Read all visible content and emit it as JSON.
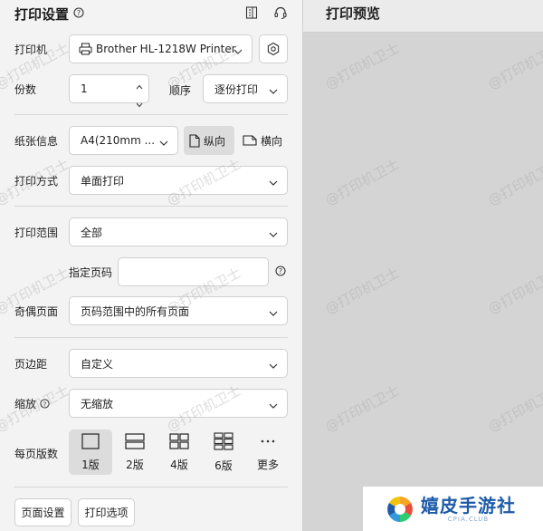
{
  "header": {
    "title": "打印设置",
    "help": "?"
  },
  "preview": {
    "title": "打印预览"
  },
  "printer": {
    "label": "打印机",
    "value": "Brother HL-1218W Printer"
  },
  "copies": {
    "label": "份数",
    "value": "1",
    "order_label": "顺序",
    "order_value": "逐份打印"
  },
  "paper": {
    "label": "纸张信息",
    "size": "A4(210mm ...",
    "portrait": "纵向",
    "landscape": "横向"
  },
  "print_mode": {
    "label": "打印方式",
    "value": "单面打印"
  },
  "range": {
    "label": "打印范围",
    "value": "全部",
    "pages_label": "指定页码",
    "pages_placeholder": ""
  },
  "odd_even": {
    "label": "奇偶页面",
    "value": "页码范围中的所有页面"
  },
  "margin": {
    "label": "页边距",
    "value": "自定义"
  },
  "scale": {
    "label": "缩放",
    "value": "无缩放"
  },
  "per_sheet": {
    "label": "每页版数",
    "options": [
      "1版",
      "2版",
      "4版",
      "6版",
      "更多"
    ],
    "selected": "1版"
  },
  "buttons": {
    "page_setup": "页面设置",
    "print_options": "打印选项"
  },
  "watermark": "@打印机卫士",
  "logo": {
    "main": "嬉皮手游社",
    "sub": "CPIA.CLUB"
  }
}
